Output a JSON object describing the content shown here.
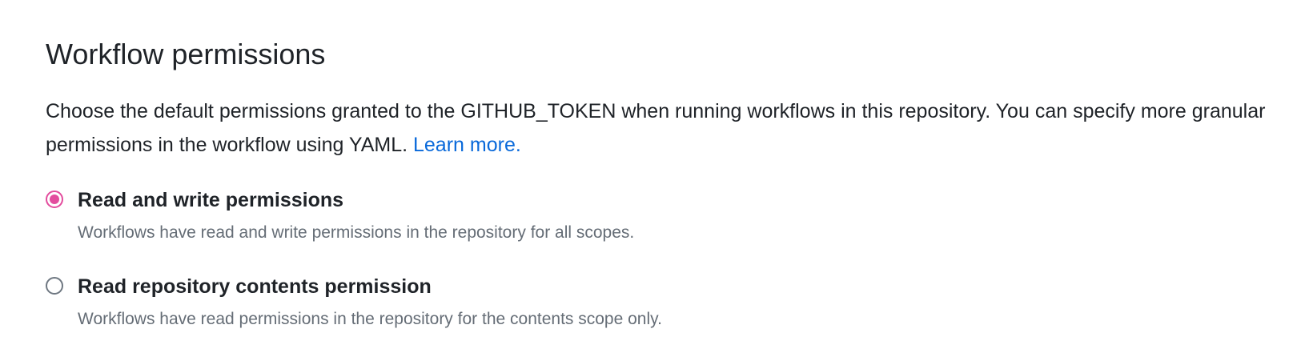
{
  "section": {
    "title": "Workflow permissions",
    "description": "Choose the default permissions granted to the GITHUB_TOKEN when running workflows in this repository. You can specify more granular permissions in the workflow using YAML.",
    "learn_more_label": "Learn more."
  },
  "options": [
    {
      "label": "Read and write permissions",
      "description": "Workflows have read and write permissions in the repository for all scopes.",
      "selected": true
    },
    {
      "label": "Read repository contents permission",
      "description": "Workflows have read permissions in the repository for the contents scope only.",
      "selected": false
    }
  ],
  "colors": {
    "accent_radio": "#e34d9e",
    "link": "#0969da",
    "text_primary": "#1f2328",
    "text_secondary": "#656d76"
  }
}
